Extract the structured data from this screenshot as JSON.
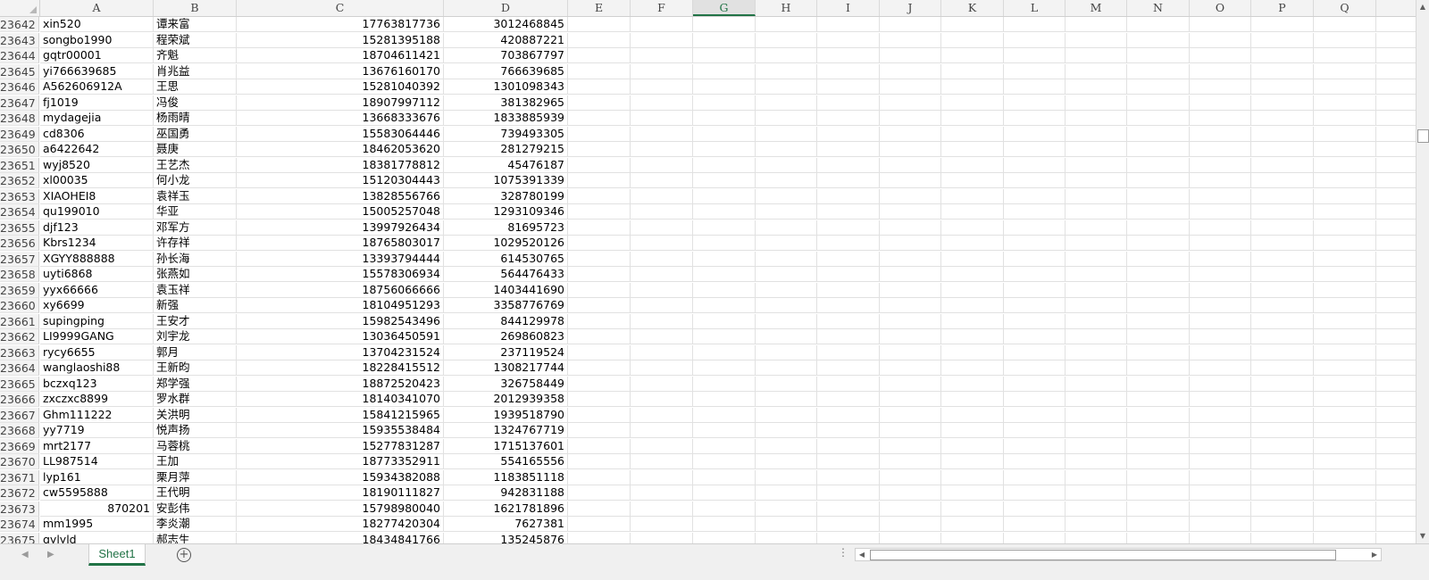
{
  "columns": [
    "A",
    "B",
    "C",
    "D",
    "E",
    "F",
    "G",
    "H",
    "I",
    "J",
    "K",
    "L",
    "M",
    "N",
    "O",
    "P",
    "Q"
  ],
  "selected_column": "G",
  "rows": [
    {
      "n": "23642",
      "a": "xin520",
      "b": "谭来富",
      "c": "17763817736",
      "d": "3012468845"
    },
    {
      "n": "23643",
      "a": "songbo1990",
      "b": "程荣斌",
      "c": "15281395188",
      "d": "420887221"
    },
    {
      "n": "23644",
      "a": "gqtr00001",
      "b": "齐魁",
      "c": "18704611421",
      "d": "703867797"
    },
    {
      "n": "23645",
      "a": "yi766639685",
      "b": "肖兆益",
      "c": "13676160170",
      "d": "766639685"
    },
    {
      "n": "23646",
      "a": "A562606912A",
      "b": "王思",
      "c": "15281040392",
      "d": "1301098343"
    },
    {
      "n": "23647",
      "a": "fj1019",
      "b": "冯俊",
      "c": "18907997112",
      "d": "381382965"
    },
    {
      "n": "23648",
      "a": "mydagejia",
      "b": "杨雨晴",
      "c": "13668333676",
      "d": "1833885939"
    },
    {
      "n": "23649",
      "a": "cd8306",
      "b": "巫国勇",
      "c": "15583064446",
      "d": "739493305"
    },
    {
      "n": "23650",
      "a": "a6422642",
      "b": "聂庚",
      "c": "18462053620",
      "d": "281279215"
    },
    {
      "n": "23651",
      "a": "wyj8520",
      "b": "王艺杰",
      "c": "18381778812",
      "d": "45476187"
    },
    {
      "n": "23652",
      "a": "xl00035",
      "b": "何小龙",
      "c": "15120304443",
      "d": "1075391339"
    },
    {
      "n": "23653",
      "a": "XIAOHEI8",
      "b": "袁祥玉",
      "c": "13828556766",
      "d": "328780199"
    },
    {
      "n": "23654",
      "a": "qu199010",
      "b": "华亚",
      "c": "15005257048",
      "d": "1293109346"
    },
    {
      "n": "23655",
      "a": "djf123",
      "b": "邓军方",
      "c": "13997926434",
      "d": "81695723"
    },
    {
      "n": "23656",
      "a": "Kbrs1234",
      "b": "许存祥",
      "c": "18765803017",
      "d": "1029520126"
    },
    {
      "n": "23657",
      "a": "XGYY888888",
      "b": "孙长海",
      "c": "13393794444",
      "d": "614530765"
    },
    {
      "n": "23658",
      "a": "uyti6868",
      "b": "张燕如",
      "c": "15578306934",
      "d": "564476433"
    },
    {
      "n": "23659",
      "a": "yyx66666",
      "b": "袁玉祥",
      "c": "18756066666",
      "d": "1403441690"
    },
    {
      "n": "23660",
      "a": "xy6699",
      "b": "新强",
      "c": "18104951293",
      "d": "3358776769"
    },
    {
      "n": "23661",
      "a": "supingping",
      "b": "王安才",
      "c": "15982543496",
      "d": "844129978"
    },
    {
      "n": "23662",
      "a": "LI9999GANG",
      "b": "刘宇龙",
      "c": "13036450591",
      "d": "269860823"
    },
    {
      "n": "23663",
      "a": "rycy6655",
      "b": "郭月",
      "c": "13704231524",
      "d": "237119524"
    },
    {
      "n": "23664",
      "a": "wanglaoshi88",
      "b": "王新昀",
      "c": "18228415512",
      "d": "1308217744"
    },
    {
      "n": "23665",
      "a": "bczxq123",
      "b": "郑学强",
      "c": "18872520423",
      "d": "326758449"
    },
    {
      "n": "23666",
      "a": "zxczxc8899",
      "b": "罗水群",
      "c": "18140341070",
      "d": "2012939358"
    },
    {
      "n": "23667",
      "a": "Ghm111222",
      "b": "关洪明",
      "c": "15841215965",
      "d": "1939518790"
    },
    {
      "n": "23668",
      "a": "yy7719",
      "b": "悦声扬",
      "c": "15935538484",
      "d": "1324767719"
    },
    {
      "n": "23669",
      "a": "mrt2177",
      "b": "马蓉桃",
      "c": "15277831287",
      "d": "1715137601"
    },
    {
      "n": "23670",
      "a": "LL987514",
      "b": "王加",
      "c": "18773352911",
      "d": "554165556"
    },
    {
      "n": "23671",
      "a": "lyp161",
      "b": "栗月萍",
      "c": "15934382088",
      "d": "1183851118"
    },
    {
      "n": "23672",
      "a": "cw5595888",
      "b": "王代明",
      "c": "18190111827",
      "d": "942831188"
    },
    {
      "n": "23673",
      "a": "870201",
      "b": "安彭伟",
      "c": "15798980040",
      "d": "1621781896",
      "a_num": true
    },
    {
      "n": "23674",
      "a": "mm1995",
      "b": "李炎潮",
      "c": "18277420304",
      "d": "7627381"
    },
    {
      "n": "23675",
      "a": "gylyld",
      "b": "郝志生",
      "c": "18434841766",
      "d": "135245876"
    }
  ],
  "tabs": {
    "sheet_name": "Sheet1",
    "add_symbol": "+",
    "dots": "⋮"
  },
  "icons": {
    "prev_sheet": "◀",
    "next_sheet": "▶",
    "scroll_up": "▲",
    "scroll_down": "▼",
    "scroll_left": "◀",
    "scroll_right": "▶"
  }
}
